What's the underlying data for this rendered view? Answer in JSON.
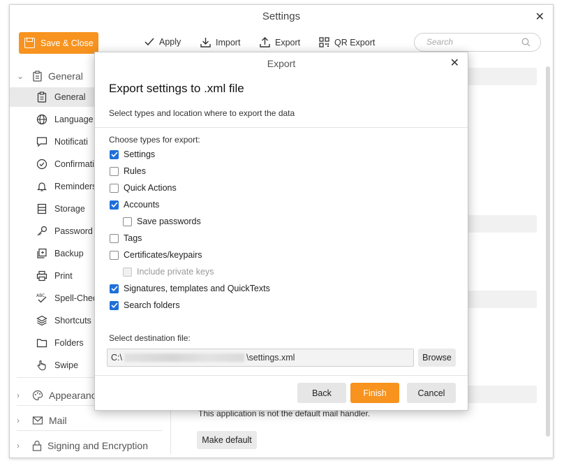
{
  "window": {
    "title": "Settings",
    "close": "✕"
  },
  "toolbar": {
    "save_close": "Save & Close",
    "apply": "Apply",
    "import": "Import",
    "export": "Export",
    "qr_export": "QR Export",
    "search_placeholder": "Search",
    "accent": "#f7931e"
  },
  "sidebar": {
    "general_group": "General",
    "items": [
      {
        "label": "General",
        "icon": "clipboard-icon",
        "selected": true
      },
      {
        "label": "Language",
        "icon": "globe-icon"
      },
      {
        "label": "Notificati",
        "icon": "message-icon"
      },
      {
        "label": "Confirmati",
        "icon": "check-circle-icon"
      },
      {
        "label": "Reminders",
        "icon": "bell-icon"
      },
      {
        "label": "Storage",
        "icon": "storage-icon"
      },
      {
        "label": "Password P",
        "icon": "key-icon"
      },
      {
        "label": "Backup",
        "icon": "backup-icon"
      },
      {
        "label": "Print",
        "icon": "printer-icon"
      },
      {
        "label": "Spell-Chec",
        "icon": "spellcheck-icon"
      },
      {
        "label": "Shortcuts",
        "icon": "layers-icon"
      },
      {
        "label": "Folders",
        "icon": "folder-icon"
      },
      {
        "label": "Swipe",
        "icon": "hand-icon"
      }
    ],
    "appearance_group": "Appearanc",
    "mail_group": "Mail",
    "signing_group": "Signing and Encryption"
  },
  "background": {
    "note": "This application is not the default mail handler.",
    "make_default": "Make default"
  },
  "dialog": {
    "title": "Export",
    "heading": "Export settings to .xml file",
    "subtitle": "Select types and location where to export the data",
    "choose_label": "Choose types for export:",
    "options": [
      {
        "label": "Settings",
        "checked": true,
        "disabled": false,
        "indent": false
      },
      {
        "label": "Rules",
        "checked": false,
        "disabled": false,
        "indent": false
      },
      {
        "label": "Quick Actions",
        "checked": false,
        "disabled": false,
        "indent": false
      },
      {
        "label": "Accounts",
        "checked": true,
        "disabled": false,
        "indent": false
      },
      {
        "label": "Save passwords",
        "checked": false,
        "disabled": false,
        "indent": true
      },
      {
        "label": "Tags",
        "checked": false,
        "disabled": false,
        "indent": false
      },
      {
        "label": "Certificates/keypairs",
        "checked": false,
        "disabled": false,
        "indent": false
      },
      {
        "label": "Include private keys",
        "checked": false,
        "disabled": true,
        "indent": true
      },
      {
        "label": "Signatures, templates and QuickTexts",
        "checked": true,
        "disabled": false,
        "indent": false
      },
      {
        "label": "Search folders",
        "checked": true,
        "disabled": false,
        "indent": false
      }
    ],
    "destination_label": "Select destination file:",
    "path_prefix": "C:\\",
    "path_suffix": "\\settings.xml",
    "browse": "Browse",
    "back": "Back",
    "finish": "Finish",
    "cancel": "Cancel",
    "check_color": "#1e6fd9"
  }
}
